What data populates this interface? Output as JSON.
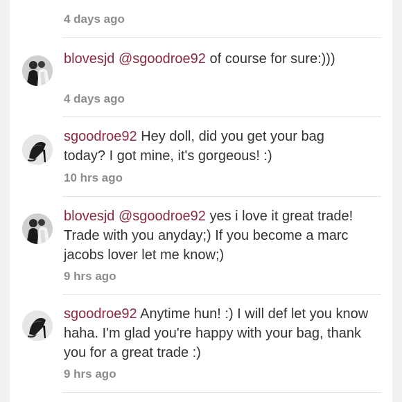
{
  "comments": [
    {
      "time": "4 days ago"
    },
    {
      "user": "blovesjd",
      "mention": "@sgoodroe92",
      "text": " of course  for sure:)))",
      "time": "4 days ago",
      "avatar_icon": "couple-photo-avatar-icon"
    },
    {
      "user": "sgoodroe92",
      "mention": "",
      "text": " Hey doll, did you get your bag today? I got mine, it's gorgeous! :)",
      "time": "10 hrs ago",
      "avatar_icon": "black-heels-avatar-icon"
    },
    {
      "user": "blovesjd",
      "mention": "@sgoodroe92",
      "text": " yes  i love it  great trade!  Trade with you anyday;)  If you become a marc jacobs lover let me know;)",
      "time": "9 hrs ago",
      "avatar_icon": "couple-photo-avatar-icon"
    },
    {
      "user": "sgoodroe92",
      "mention": "",
      "text": " Anytime hun! :) I will def let you know haha. I'm glad you're happy with your bag, thank you for a great trade :)",
      "time": "9 hrs ago",
      "avatar_icon": "black-heels-avatar-icon"
    }
  ],
  "colors": {
    "username": "#8a2a40",
    "body_text": "#333333",
    "timestamp": "#8c8c8c",
    "divider": "#e3e3e3"
  }
}
